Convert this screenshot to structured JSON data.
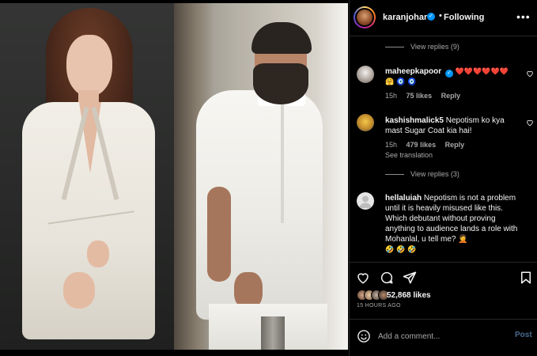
{
  "post": {
    "author": "karanjohar",
    "follow_status": "Following",
    "separator": "•",
    "more_icon": "more-horizontal-icon"
  },
  "comments": [
    {
      "type": "view_replies",
      "label": "View replies (9)"
    },
    {
      "type": "comment",
      "username": "maheepkapoor",
      "verified": true,
      "text": "",
      "emojis": [
        "❤️",
        "❤️",
        "❤️",
        "❤️",
        "❤️",
        "❤️",
        "🤗",
        "🧿",
        "🧿"
      ],
      "time": "15h",
      "likes": "75 likes",
      "reply": "Reply"
    },
    {
      "type": "comment",
      "username": "kashishmalick5",
      "verified": false,
      "text": "Nepotism ko kya mast Sugar Coat kia hai!",
      "time": "15h",
      "likes": "479 likes",
      "reply": "Reply",
      "see_translation": "See translation"
    },
    {
      "type": "view_replies",
      "label": "View replies (3)"
    },
    {
      "type": "comment",
      "username": "hellaluiah",
      "verified": false,
      "text": "Nepotism is not a problem until it is heavily misused like this. Which debutant without proving anything to audience lands a role with Mohanlal, u tell me? 🤦",
      "emojis": [
        "🤣",
        "🤣",
        "🤣"
      ]
    }
  ],
  "actions": {
    "like_icon": "heart-icon",
    "comment_icon": "comment-icon",
    "share_icon": "share-icon",
    "save_icon": "bookmark-icon",
    "likes_count": "52,868 likes",
    "time_ago": "15 HOURS AGO"
  },
  "add_comment": {
    "emoji_icon": "emoji-icon",
    "placeholder": "Add a comment...",
    "post_label": "Post"
  },
  "colors": {
    "background": "#000000",
    "text": "#f5f5f5",
    "muted": "#a8a8a8",
    "verified": "#0095f6",
    "heart_red": "#ed4956",
    "post_disabled": "#4a6c8f"
  }
}
